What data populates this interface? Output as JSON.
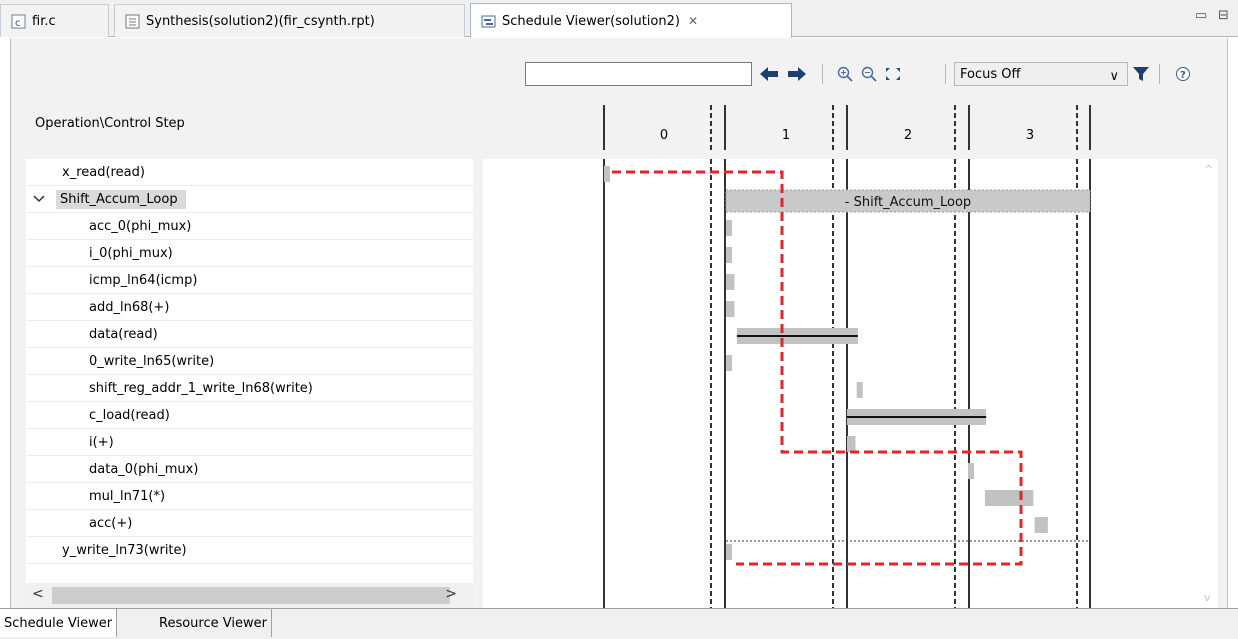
{
  "tabs": [
    {
      "label": "fir.c",
      "icon": "c-file-icon",
      "active": false
    },
    {
      "label": "Synthesis(solution2)(fir_csynth.rpt)",
      "icon": "report-file-icon",
      "active": false
    },
    {
      "label": "Schedule Viewer(solution2)",
      "icon": "schedule-viewer-icon",
      "active": true,
      "close": "✕"
    }
  ],
  "window_controls": {
    "minimize": "▭",
    "maximize": "⊟"
  },
  "toolbar": {
    "search_value": "",
    "focus_value": "Focus Off",
    "focus_arrow": "∨",
    "icons": [
      "arrow-left-icon",
      "arrow-right-icon",
      "zoom-in-icon",
      "zoom-out-icon",
      "zoom-fit-icon",
      "filter-icon",
      "help-icon"
    ]
  },
  "header": {
    "operation_label": "Operation\\Control Step"
  },
  "control_steps": [
    "0",
    "1",
    "2",
    "3"
  ],
  "operations": [
    {
      "label": "x_read(read)",
      "indent": 0,
      "expandable": false,
      "bar": {
        "start": 0,
        "width": 0.05
      }
    },
    {
      "label": "Shift_Accum_Loop",
      "indent": 0,
      "expandable": true,
      "expanded": true,
      "selected": true,
      "loop_bar_label": "- Shift_Accum_Loop"
    },
    {
      "label": "acc_0(phi_mux)",
      "indent": 1,
      "bar": {
        "start": 1,
        "width": 0.05
      }
    },
    {
      "label": "i_0(phi_mux)",
      "indent": 1,
      "bar": {
        "start": 1,
        "width": 0.05
      }
    },
    {
      "label": "icmp_ln64(icmp)",
      "indent": 1,
      "bar": {
        "start": 1,
        "width": 0.07
      }
    },
    {
      "label": "add_ln68(+)",
      "indent": 1,
      "bar": {
        "start": 1,
        "width": 0.07
      }
    },
    {
      "label": "data(read)",
      "indent": 1,
      "bar": {
        "start": 1.09,
        "width": 1.0
      }
    },
    {
      "label": "0_write_ln65(write)",
      "indent": 1,
      "bar": {
        "start": 1,
        "width": 0.05
      }
    },
    {
      "label": "shift_reg_addr_1_write_ln68(write)",
      "indent": 1,
      "bar": {
        "start": 2.08,
        "width": 0.05
      }
    },
    {
      "label": "c_load(read)",
      "indent": 1,
      "bar": {
        "start": 2.0,
        "width": 1.15
      }
    },
    {
      "label": "i(+)",
      "indent": 1,
      "bar": {
        "start": 2.0,
        "width": 0.07
      }
    },
    {
      "label": "data_0(phi_mux)",
      "indent": 1,
      "bar": {
        "start": 3.0,
        "width": 0.05
      }
    },
    {
      "label": "mul_ln71(*)",
      "indent": 1,
      "bar": {
        "start": 3.14,
        "width": 0.4
      }
    },
    {
      "label": "acc(+)",
      "indent": 1,
      "bar": {
        "start": 3.55,
        "width": 0.11
      }
    },
    {
      "label": "y_write_ln73(write)",
      "indent": 0,
      "bar": {
        "start": 1,
        "width": 0.05
      }
    }
  ],
  "hscroll": {
    "left": "<",
    "right": ">"
  },
  "vscroll": {
    "up": "^",
    "down": "v"
  },
  "bottom_tabs": [
    {
      "label": "Schedule Viewer",
      "active": true
    },
    {
      "label": "Resource Viewer",
      "active": false
    }
  ],
  "colors": {
    "critical_path": "#e8232a",
    "bar": "#c2c2c2",
    "loop_bar": "#c9c9c9"
  }
}
